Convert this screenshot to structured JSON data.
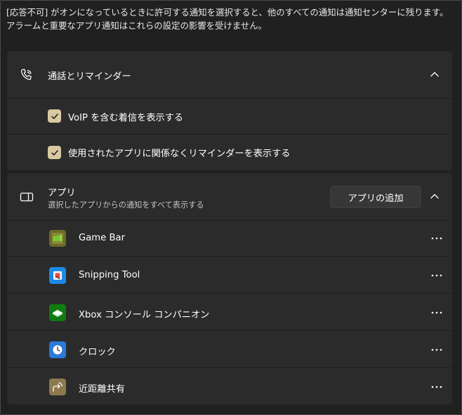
{
  "description": "[応答不可] がオンになっているときに許可する通知を選択すると、他のすべての通知は通知センターに残ります。アラームと重要なアプリ通知はこれらの設定の影響を受けません。",
  "calls_section": {
    "title": "通話とリマインダー",
    "icon": "phone-icon",
    "options": [
      {
        "label": "VoIP を含む着信を表示する",
        "checked": true
      },
      {
        "label": "使用されたアプリに関係なくリマインダーを表示する",
        "checked": true
      }
    ]
  },
  "apps_section": {
    "title": "アプリ",
    "subtitle": "選択したアプリからの通知をすべて表示する",
    "icon": "apps-icon",
    "add_button": "アプリの追加",
    "apps": [
      {
        "name": "Game Bar",
        "icon": "game-bar-icon"
      },
      {
        "name": "Snipping Tool",
        "icon": "snipping-tool-icon"
      },
      {
        "name": "Xbox コンソール コンパニオン",
        "icon": "xbox-icon"
      },
      {
        "name": "クロック",
        "icon": "clock-icon"
      },
      {
        "name": "近距離共有",
        "icon": "nearby-share-icon"
      }
    ]
  },
  "colors": {
    "background": "#202020",
    "card": "#2b2b2b",
    "accent_checkbox": "#d9c9a2"
  }
}
